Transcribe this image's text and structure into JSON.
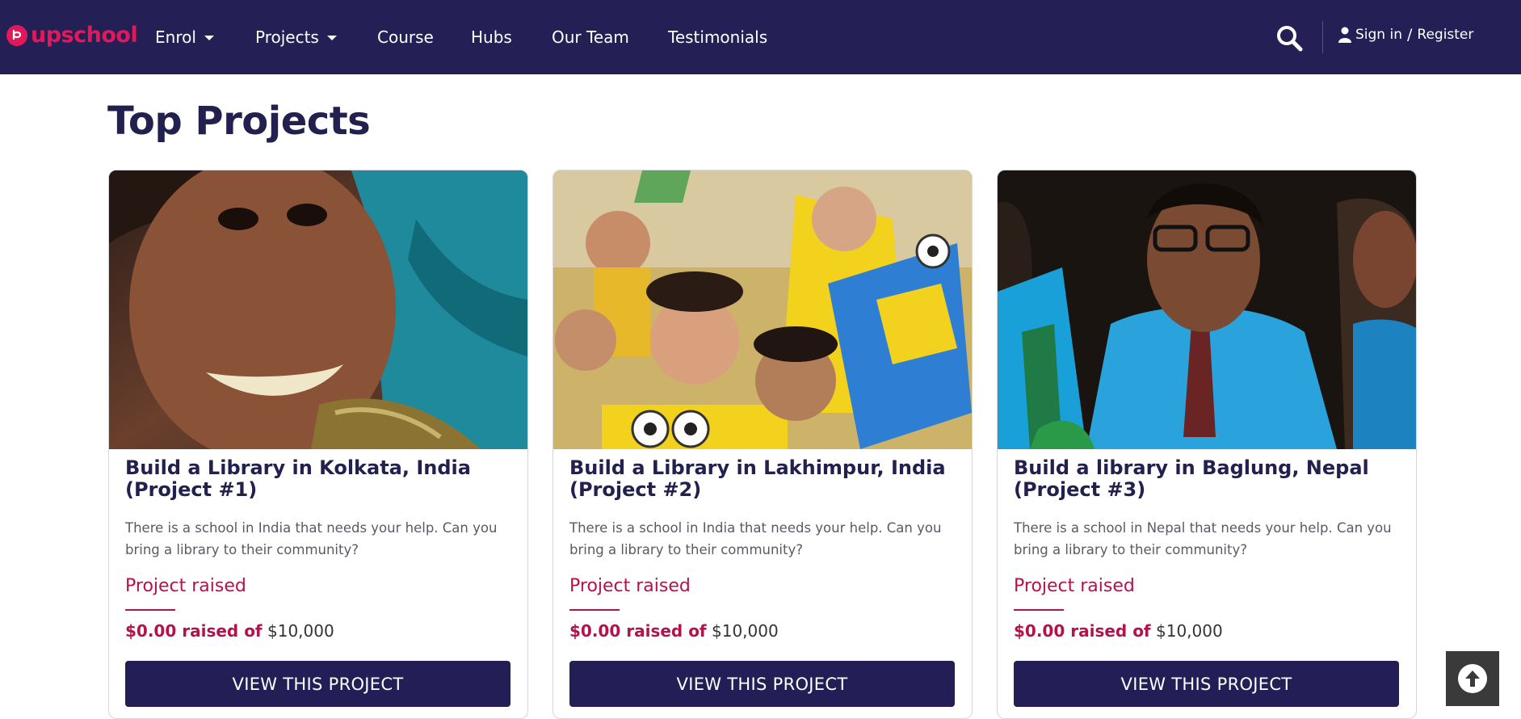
{
  "brand": {
    "logo_text": "upschool",
    "accent_color": "#e0195a"
  },
  "nav": {
    "items": [
      {
        "label": "Enrol",
        "dropdown": true
      },
      {
        "label": "Projects",
        "dropdown": true
      },
      {
        "label": "Course",
        "dropdown": false
      },
      {
        "label": "Hubs",
        "dropdown": false
      },
      {
        "label": "Our Team",
        "dropdown": false
      },
      {
        "label": "Testimonials",
        "dropdown": false
      }
    ],
    "search_icon": "search-icon",
    "sign_in": "Sign in",
    "separator": "/",
    "register": "Register",
    "background": "#241f54"
  },
  "page": {
    "title": "Top Projects"
  },
  "projects": [
    {
      "title": "Build a Library in Kolkata, India (Project #1)",
      "description": "There is a school in India that needs your help. Can you bring a library to their community?",
      "raised_label": "Project raised",
      "raised_amount": "$0.00 raised of",
      "goal": "$10,000",
      "progress": 0,
      "button_label": "VIEW THIS PROJECT"
    },
    {
      "title": "Build a Library in Lakhimpur, India (Project #2)",
      "description": "There is a school in India that needs your help. Can you bring a library to their community?",
      "raised_label": "Project raised",
      "raised_amount": "$0.00 raised of",
      "goal": "$10,000",
      "progress": 0,
      "button_label": "VIEW THIS PROJECT"
    },
    {
      "title": "Build a library in Baglung, Nepal (Project #3)",
      "description": "There is a school in Nepal that needs your help. Can you bring a library to their community?",
      "raised_label": "Project raised",
      "raised_amount": "$0.00 raised of",
      "goal": "$10,000",
      "progress": 0,
      "button_label": "VIEW THIS PROJECT"
    }
  ],
  "back_to_top_icon": "arrow-up-circle-icon"
}
